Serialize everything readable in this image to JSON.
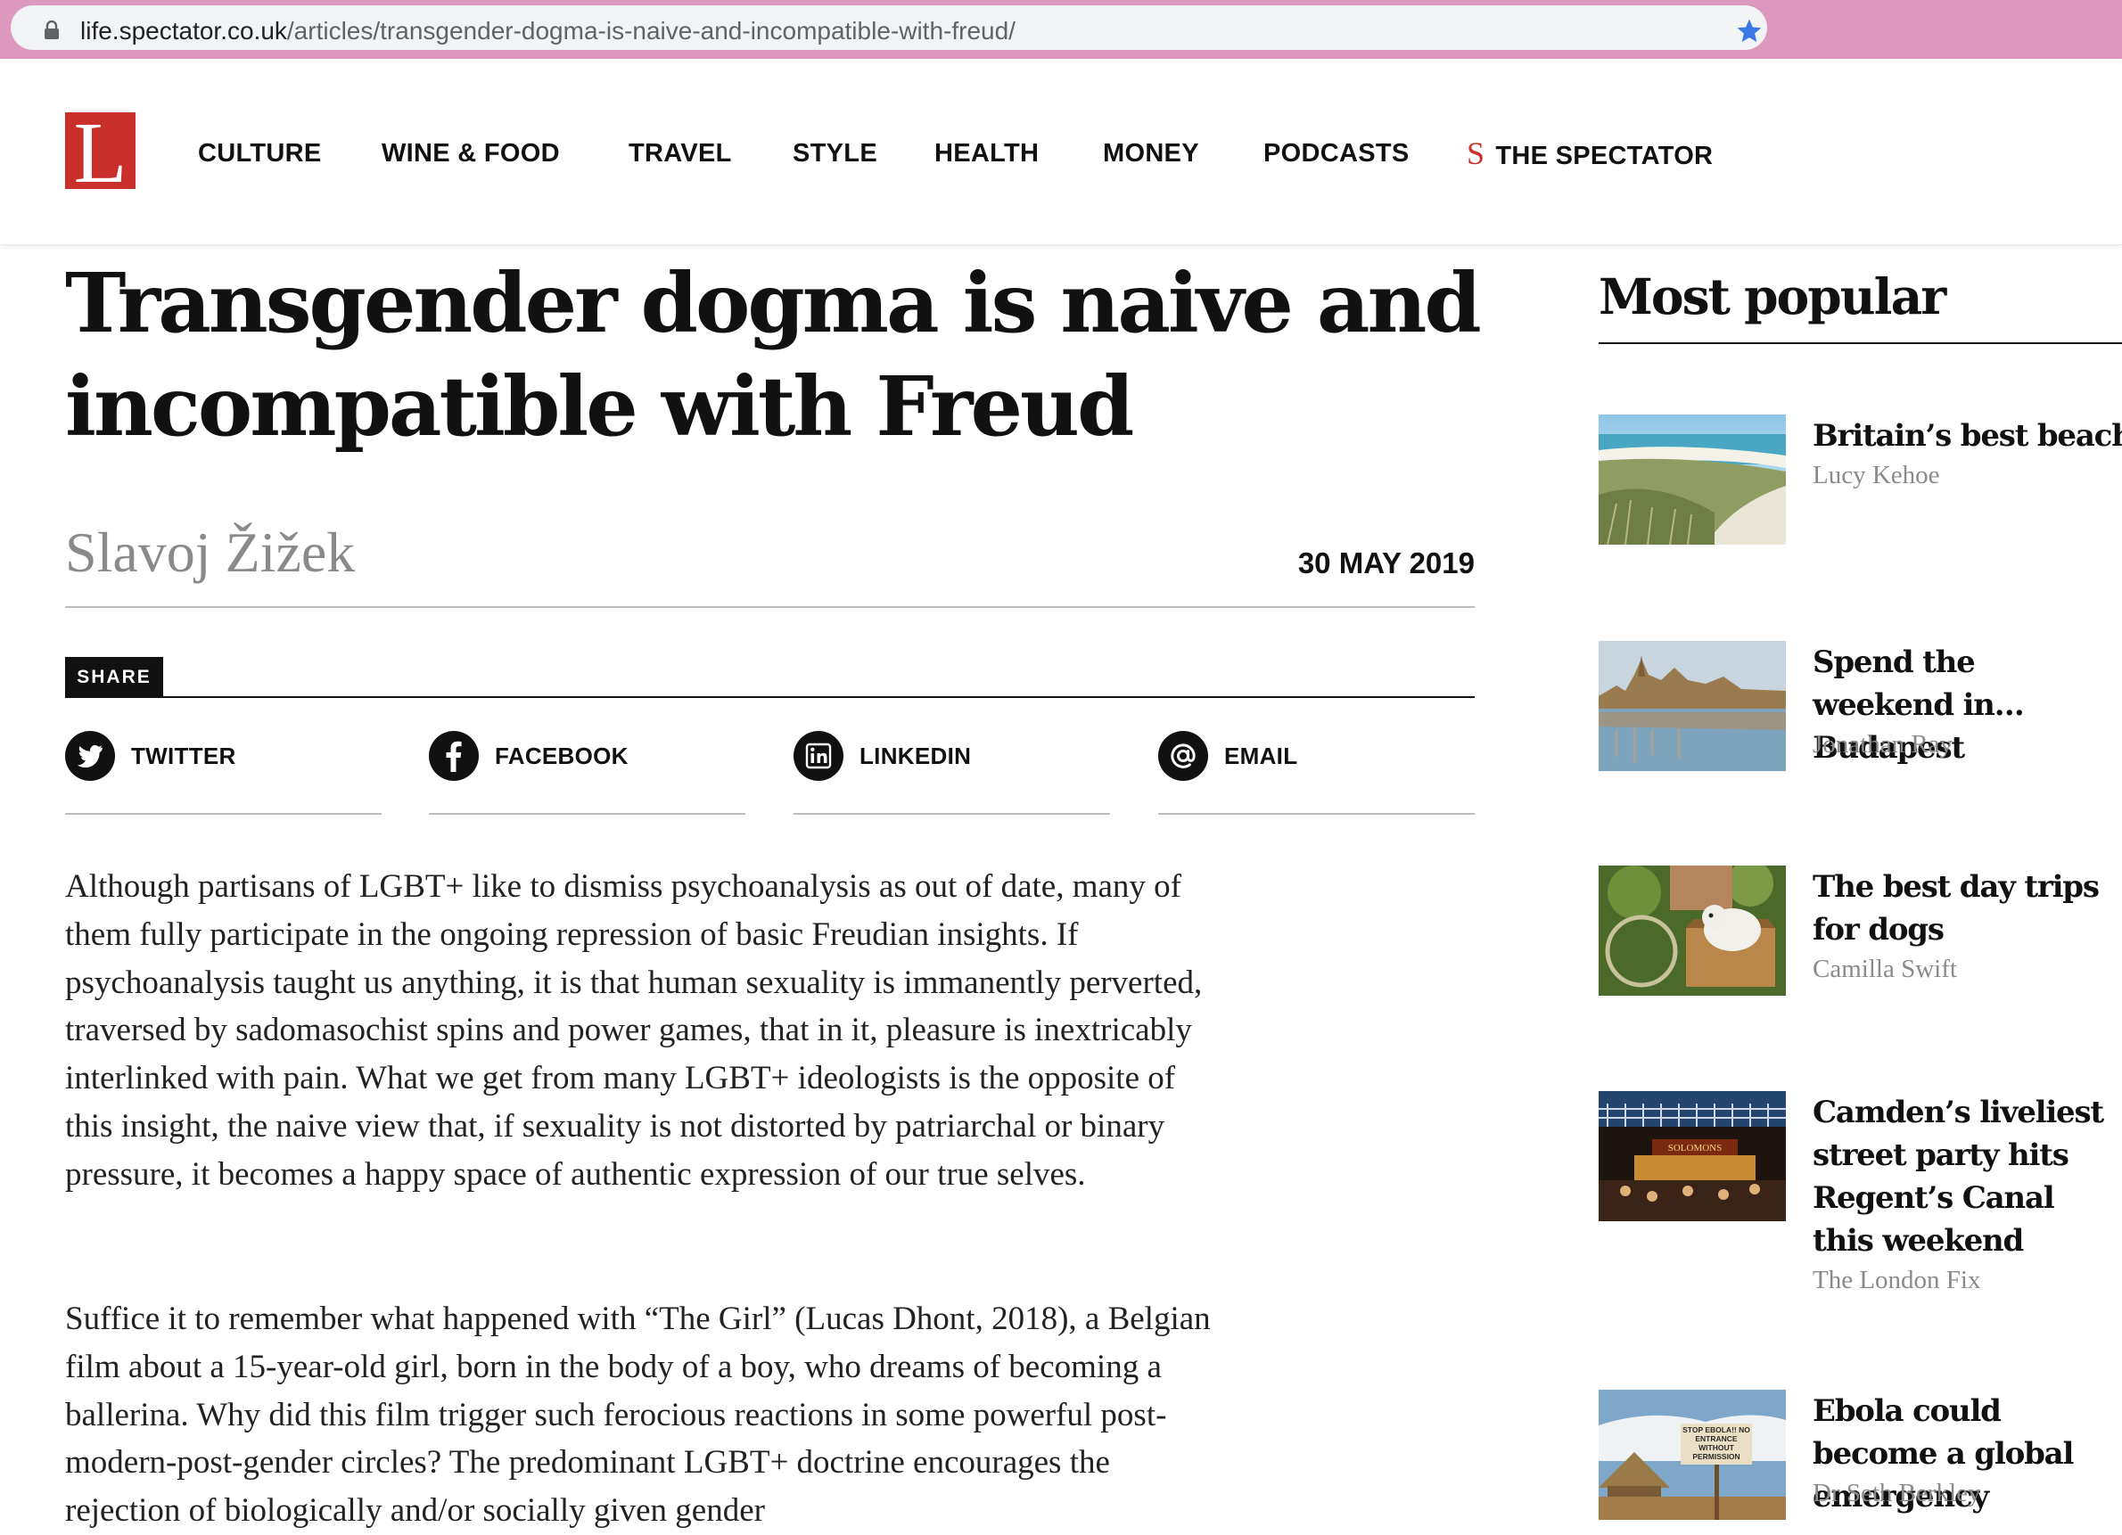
{
  "browser": {
    "url_host": "life.spectator.co.uk",
    "url_path": "/articles/transgender-dogma-is-naive-and-incompatible-with-freud/"
  },
  "site": {
    "logo_letter": "L",
    "nav": [
      "CULTURE",
      "WINE & FOOD",
      "TRAVEL",
      "STYLE",
      "HEALTH",
      "MONEY",
      "PODCASTS"
    ],
    "spectator_mark": "S",
    "spectator_label": "THE SPECTATOR",
    "accent_color": "#c9302c"
  },
  "article": {
    "headline": "Transgender dogma is naive and incompatible with Freud",
    "author": "Slavoj Žižek",
    "date": "30 MAY 2019",
    "share_label": "SHARE",
    "share_buttons": [
      {
        "label": "TWITTER",
        "icon": "twitter-icon"
      },
      {
        "label": "FACEBOOK",
        "icon": "facebook-icon"
      },
      {
        "label": "LINKEDIN",
        "icon": "linkedin-icon"
      },
      {
        "label": "EMAIL",
        "icon": "email-icon"
      }
    ],
    "paragraphs": [
      "Although partisans of LGBT+ like to dismiss psychoanalysis as out of date, many of them fully participate in the ongoing repression of basic Freudian insights. If psychoanalysis taught us anything, it is that human sexuality is immanently perverted, traversed by sadomasochist spins and power games, that in it, pleasure is inextricably interlinked with pain. What we get from many LGBT+ ideologists is the opposite of this insight, the naive view that, if sexuality is not distorted by patriarchal or binary pressure, it becomes a happy space of authentic expression of our true selves.",
      "Suffice it to remember what happened with “The Girl” (Lucas Dhont, 2018), a Belgian film about a 15-year-old girl, born in the body of a boy, who dreams of becoming a ballerina. Why did this film trigger such ferocious reactions in some powerful post-modern-post-gender circles? The predominant LGBT+ doctrine encourages the rejection of biologically and/or socially given gender"
    ]
  },
  "most_popular": {
    "title": "Most popular",
    "items": [
      {
        "title": "Britain’s best beaches",
        "author": "Lucy Kehoe",
        "image": "beach-photo"
      },
      {
        "title": "Spend the weekend in…Budapest",
        "author": "Jonathan Ray",
        "image": "budapest-photo"
      },
      {
        "title": "The best day trips for dogs",
        "author": "Camilla Swift",
        "image": "dog-photo"
      },
      {
        "title": "Camden’s liveliest street party hits Regent’s Canal this weekend",
        "author": "The London Fix",
        "image": "camden-photo",
        "sign_text": "SOLOMONS"
      },
      {
        "title": "Ebola could become a global emergency",
        "author": "Dr Seth Berkley",
        "image": "ebola-photo",
        "sign_text": "STOP EBOLA!! NO ENTRANCE WITHOUT PERMISSION"
      }
    ]
  }
}
